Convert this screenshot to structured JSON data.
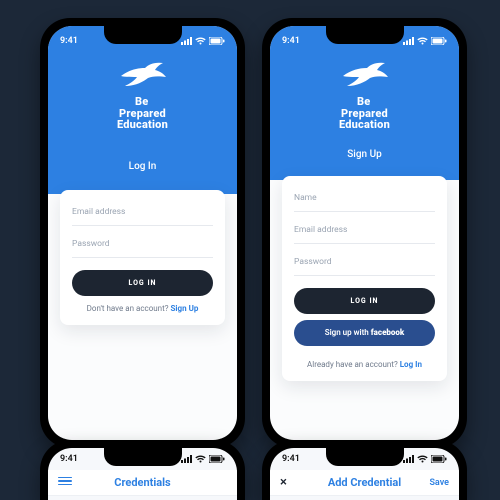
{
  "colors": {
    "bg": "#1c2838",
    "primary": "#2d80e2",
    "dark": "#1d2531",
    "facebook": "#2a4e8f"
  },
  "status": {
    "time": "9:41",
    "signal_icon": "signal-icon",
    "wifi_icon": "wifi-icon",
    "battery_icon": "battery-icon"
  },
  "brand": {
    "line1": "Be",
    "line2": "Prepared",
    "line3": "Education",
    "logo": "bird-logo"
  },
  "login": {
    "title": "Log In",
    "email_placeholder": "Email address",
    "password_placeholder": "Password",
    "submit": "LOG IN",
    "footer_text": "Don't have an account? ",
    "footer_link": "Sign Up"
  },
  "signup": {
    "title": "Sign Up",
    "name_placeholder": "Name",
    "email_placeholder": "Email address",
    "password_placeholder": "Password",
    "submit": "LOG IN",
    "facebook_prefix": "Sign up with ",
    "facebook_bold": "facebook",
    "footer_text": "Already have an account? ",
    "footer_link": "Log In"
  },
  "row2": {
    "left": {
      "title": "Credentials",
      "left_icon": "hamburger-icon"
    },
    "right": {
      "title": "Add Credential",
      "left_icon": "close-icon",
      "right_action": "Save"
    }
  }
}
